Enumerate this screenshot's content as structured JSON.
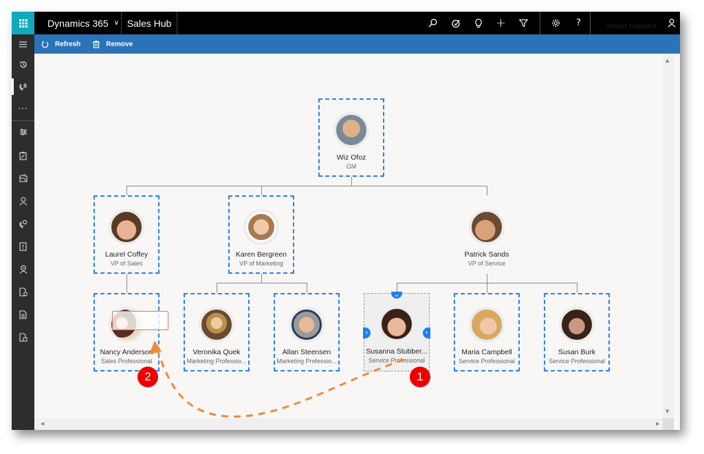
{
  "topbar": {
    "app_name": "Dynamics 365",
    "area_name": "Sales Hub",
    "icons": [
      "search-icon",
      "task-icon",
      "lightbulb-icon",
      "plus-icon",
      "filter-icon",
      "gear-icon",
      "help-icon"
    ],
    "help_glyph": "?",
    "plus_glyph": "+",
    "user_name": "Jesper Osgaard"
  },
  "commands": {
    "refresh_label": "Refresh",
    "remove_label": "Remove"
  },
  "sidebar": {
    "items": [
      "menu",
      "recent",
      "phone-contact",
      "more",
      "settings-tools",
      "clipboard",
      "documents",
      "contact",
      "phone-sync",
      "alert-notebook",
      "person-alert",
      "document-report",
      "document",
      "document-list"
    ]
  },
  "org_chart": {
    "root": {
      "name": "Wiz Ofoz",
      "title": "GM",
      "avatar_color": "#9a7b5a"
    },
    "level1": [
      {
        "name": "Laurel Coffey",
        "title": "VP of Sales",
        "avatar_color": "#a9745a"
      },
      {
        "name": "Karen Bergreen",
        "title": "VP of Marketing",
        "avatar_color": "#c9a07b"
      },
      {
        "name": "Patrick Sands",
        "title": "VP of Service",
        "avatar_color": "#8a6b4f"
      }
    ],
    "level2": [
      {
        "name": "Nancy Anderson",
        "title": "Sales Professional",
        "avatar_color": "#6b3a2e"
      },
      {
        "name": "Veronika Quek",
        "title": "Marketing Professio...",
        "avatar_color": "#7b5a3d"
      },
      {
        "name": "Allan Steensen",
        "title": "Marketing Professio...",
        "avatar_color": "#8c8c8c"
      },
      {
        "name": "Susanna Stubber...",
        "title": "Service Professional",
        "avatar_color": "#5a3a2a"
      },
      {
        "name": "Maria Campbell",
        "title": "Service Professional",
        "avatar_color": "#d0a070"
      },
      {
        "name": "Susan Burk",
        "title": "Service Professional",
        "avatar_color": "#6b4a3a"
      }
    ]
  },
  "annotations": {
    "badge1": "1",
    "badge2": "2",
    "arrow_color": "#ef8a3a",
    "badge_color": "#ee0000"
  },
  "colors": {
    "command_bar": "#2a73b6",
    "waffle": "#11aabb",
    "card_border": "#2a7ff0"
  }
}
